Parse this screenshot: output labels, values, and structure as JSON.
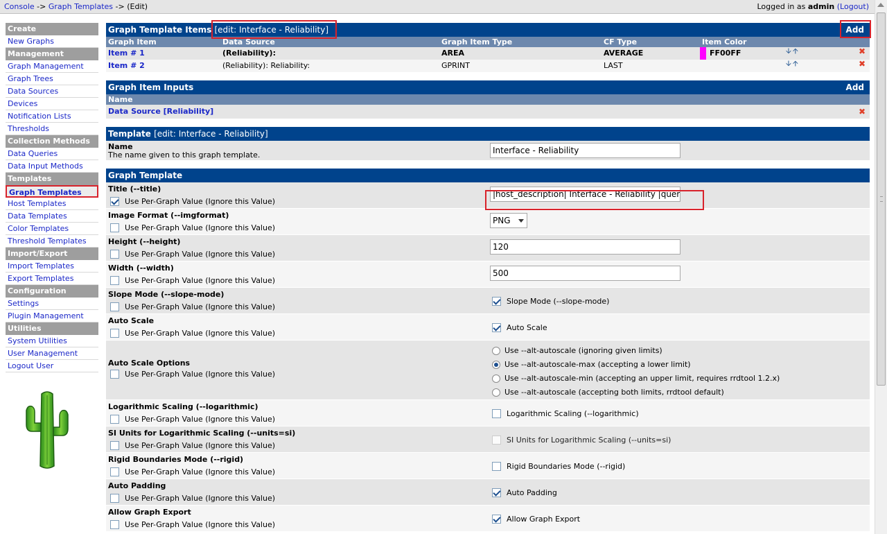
{
  "topbar": {
    "crumb_console": "Console",
    "crumb_sep1": "->",
    "crumb_templates": "Graph Templates",
    "crumb_sep2": "->",
    "crumb_edit": "(Edit)",
    "logged_in_prefix": "Logged in as",
    "user": "admin",
    "logout": "(Logout)"
  },
  "sidebar": [
    {
      "type": "head",
      "label": "Create"
    },
    {
      "type": "item",
      "label": "New Graphs"
    },
    {
      "type": "head",
      "label": "Management"
    },
    {
      "type": "item",
      "label": "Graph Management"
    },
    {
      "type": "item",
      "label": "Graph Trees"
    },
    {
      "type": "item",
      "label": "Data Sources"
    },
    {
      "type": "item",
      "label": "Devices"
    },
    {
      "type": "item",
      "label": "Notification Lists"
    },
    {
      "type": "item",
      "label": "Thresholds"
    },
    {
      "type": "head",
      "label": "Collection Methods"
    },
    {
      "type": "item",
      "label": "Data Queries"
    },
    {
      "type": "item",
      "label": "Data Input Methods"
    },
    {
      "type": "head",
      "label": "Templates"
    },
    {
      "type": "item",
      "label": "Graph Templates",
      "selected": true
    },
    {
      "type": "item",
      "label": "Host Templates"
    },
    {
      "type": "item",
      "label": "Data Templates"
    },
    {
      "type": "item",
      "label": "Color Templates"
    },
    {
      "type": "item",
      "label": "Threshold Templates"
    },
    {
      "type": "head",
      "label": "Import/Export"
    },
    {
      "type": "item",
      "label": "Import Templates"
    },
    {
      "type": "item",
      "label": "Export Templates"
    },
    {
      "type": "head",
      "label": "Configuration"
    },
    {
      "type": "item",
      "label": "Settings"
    },
    {
      "type": "item",
      "label": "Plugin Management"
    },
    {
      "type": "head",
      "label": "Utilities"
    },
    {
      "type": "item",
      "label": "System Utilities"
    },
    {
      "type": "item",
      "label": "User Management"
    },
    {
      "type": "item",
      "label": "Logout User"
    }
  ],
  "items_box": {
    "title": "Graph Template Items",
    "edit": "[edit: Interface - Reliability]",
    "add": "Add",
    "columns": [
      "Graph Item",
      "Data Source",
      "Graph Item Type",
      "CF Type",
      "Item Color"
    ],
    "rows": [
      {
        "item": "Item # 1",
        "source": "(Reliability):",
        "type": "AREA",
        "cf": "AVERAGE",
        "color": "FF00FF",
        "color_hex": "#ff00ff"
      },
      {
        "item": "Item # 2",
        "source": "(Reliability): Reliability:",
        "type": "GPRINT",
        "cf": "LAST",
        "color": ""
      }
    ]
  },
  "inputs_box": {
    "title": "Graph Item Inputs",
    "add": "Add",
    "column": "Name",
    "row": "Data Source [Reliability]"
  },
  "template_box": {
    "title": "Template",
    "edit": "[edit: Interface - Reliability]",
    "name_label": "Name",
    "name_desc": "The name given to this graph template.",
    "name_value": "Interface - Reliability"
  },
  "graph_box": {
    "title": "Graph Template",
    "per_graph": "Use Per-Graph Value (Ignore this Value)",
    "title_label": "Title (--title)",
    "title_value": "|host_description| Interface -  Reliability  |query_ifName|",
    "imgformat_label": "Image Format (--imgformat)",
    "imgformat_value": "PNG",
    "height_label": "Height (--height)",
    "height_value": "120",
    "width_label": "Width (--width)",
    "width_value": "500",
    "slope_label": "Slope Mode (--slope-mode)",
    "slope_check": "Slope Mode (--slope-mode)",
    "autoscale_label": "Auto Scale",
    "autoscale_check": "Auto Scale",
    "aso_label": "Auto Scale Options",
    "aso_options": [
      "Use --alt-autoscale (ignoring given limits)",
      "Use --alt-autoscale-max (accepting a lower limit)",
      "Use --alt-autoscale-min (accepting an upper limit, requires rrdtool 1.2.x)",
      "Use --alt-autoscale (accepting both limits, rrdtool default)"
    ],
    "log_label": "Logarithmic Scaling (--logarithmic)",
    "log_check": "Logarithmic Scaling (--logarithmic)",
    "si_label": "SI Units for Logarithmic Scaling (--units=si)",
    "si_check": "SI Units for Logarithmic Scaling (--units=si)",
    "rigid_label": "Rigid Boundaries Mode (--rigid)",
    "rigid_check": "Rigid Boundaries Mode (--rigid)",
    "pad_label": "Auto Padding",
    "pad_check": "Auto Padding",
    "export_label": "Allow Graph Export",
    "export_check": "Allow Graph Export"
  },
  "colors": {
    "header_blue": "#00438c",
    "column_blue": "#6d88ad",
    "highlight_red": "#d8222b",
    "swatch": "#ff00ff"
  }
}
